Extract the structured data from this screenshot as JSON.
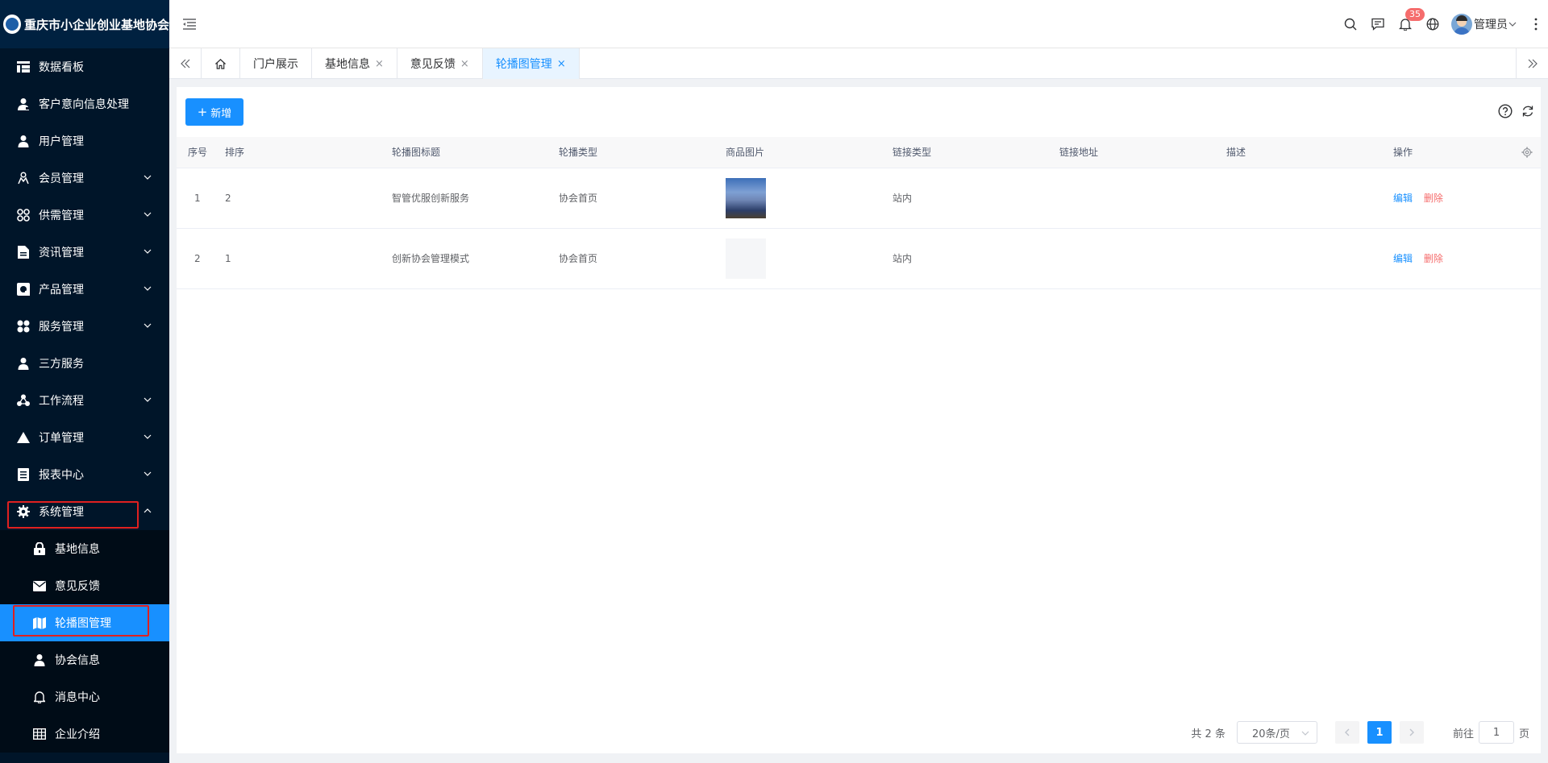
{
  "brand": {
    "title": "重庆市小企业创业基地协会"
  },
  "sidebar": {
    "items": [
      {
        "label": "数据看板",
        "icon": "dashboard-icon",
        "has_arrow": false
      },
      {
        "label": "客户意向信息处理",
        "icon": "user-tie-icon",
        "has_arrow": false
      },
      {
        "label": "用户管理",
        "icon": "user-icon",
        "has_arrow": false
      },
      {
        "label": "会员管理",
        "icon": "members-icon",
        "has_arrow": true
      },
      {
        "label": "供需管理",
        "icon": "cluster-icon",
        "has_arrow": true
      },
      {
        "label": "资讯管理",
        "icon": "document-icon",
        "has_arrow": true
      },
      {
        "label": "产品管理",
        "icon": "product-icon",
        "has_arrow": true
      },
      {
        "label": "服务管理",
        "icon": "service-icon",
        "has_arrow": true
      },
      {
        "label": "三方服务",
        "icon": "user-icon",
        "has_arrow": false
      },
      {
        "label": "工作流程",
        "icon": "workflow-icon",
        "has_arrow": true
      },
      {
        "label": "订单管理",
        "icon": "triangle-icon",
        "has_arrow": true
      },
      {
        "label": "报表中心",
        "icon": "report-icon",
        "has_arrow": true
      },
      {
        "label": "系统管理",
        "icon": "gear-icon",
        "has_arrow": true,
        "expanded": true
      }
    ],
    "sub_items": [
      {
        "label": "基地信息",
        "icon": "lock-icon"
      },
      {
        "label": "意见反馈",
        "icon": "mail-icon"
      },
      {
        "label": "轮播图管理",
        "icon": "map-icon",
        "active": true
      },
      {
        "label": "协会信息",
        "icon": "user-icon"
      },
      {
        "label": "消息中心",
        "icon": "bell-icon"
      },
      {
        "label": "企业介绍",
        "icon": "grid-icon"
      }
    ]
  },
  "header": {
    "notification_count": "35",
    "user_name": "管理员"
  },
  "tabs": [
    {
      "label": "门户展示",
      "closable": false
    },
    {
      "label": "基地信息",
      "closable": true
    },
    {
      "label": "意见反馈",
      "closable": true
    },
    {
      "label": "轮播图管理",
      "closable": true,
      "active": true
    }
  ],
  "tab_close_glyph": "×",
  "toolbar": {
    "add_label": "新增",
    "add_glyph": "+"
  },
  "table": {
    "columns": [
      "序号",
      "排序",
      "轮播图标题",
      "轮播类型",
      "商品图片",
      "链接类型",
      "链接地址",
      "描述",
      "操作"
    ],
    "rows": [
      {
        "index": "1",
        "sort": "2",
        "title": "智管优服创新服务",
        "type": "协会首页",
        "image": "banner-thumbnail",
        "link_type": "站内",
        "link_url": "",
        "desc": ""
      },
      {
        "index": "2",
        "sort": "1",
        "title": "创新协会管理模式",
        "type": "协会首页",
        "image": "empty-thumbnail",
        "link_type": "站内",
        "link_url": "",
        "desc": ""
      }
    ],
    "edit_label": "编辑",
    "delete_label": "删除"
  },
  "pagination": {
    "total_text": "共 2 条",
    "page_size": "20条/页",
    "current_page": "1",
    "goto_prefix": "前往",
    "goto_value": "1",
    "goto_suffix": "页"
  },
  "colors": {
    "sidebar_bg": "#001529",
    "accent": "#1890ff",
    "danger": "#f56c6c",
    "highlight_box": "#e02020"
  }
}
